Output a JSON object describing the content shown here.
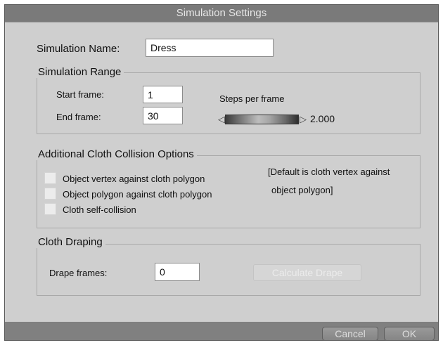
{
  "window": {
    "title": "Simulation Settings"
  },
  "simulation_name": {
    "label": "Simulation Name:",
    "value": "Dress"
  },
  "simulation_range": {
    "title": "Simulation Range",
    "start_label": "Start frame:",
    "start_value": "1",
    "end_label": "End frame:",
    "end_value": "30",
    "steps_label": "Steps per frame",
    "steps_value": "2.000"
  },
  "collision": {
    "title": "Additional Cloth Collision Options",
    "options": [
      {
        "label": "Object vertex against cloth polygon",
        "checked": false
      },
      {
        "label": "Object polygon against cloth polygon",
        "checked": false
      },
      {
        "label": "Cloth self-collision",
        "checked": false
      }
    ],
    "note_line1": "[Default is cloth vertex against",
    "note_line2": "object polygon]"
  },
  "draping": {
    "title": "Cloth Draping",
    "frames_label": "Drape frames:",
    "frames_value": "0",
    "calculate_label": "Calculate Drape"
  },
  "footer": {
    "cancel_label": "Cancel",
    "ok_label": "OK"
  },
  "colors": {
    "panel": "#cfcfcf",
    "frame": "#7f7f7f",
    "disabled_text": "#ececec"
  }
}
